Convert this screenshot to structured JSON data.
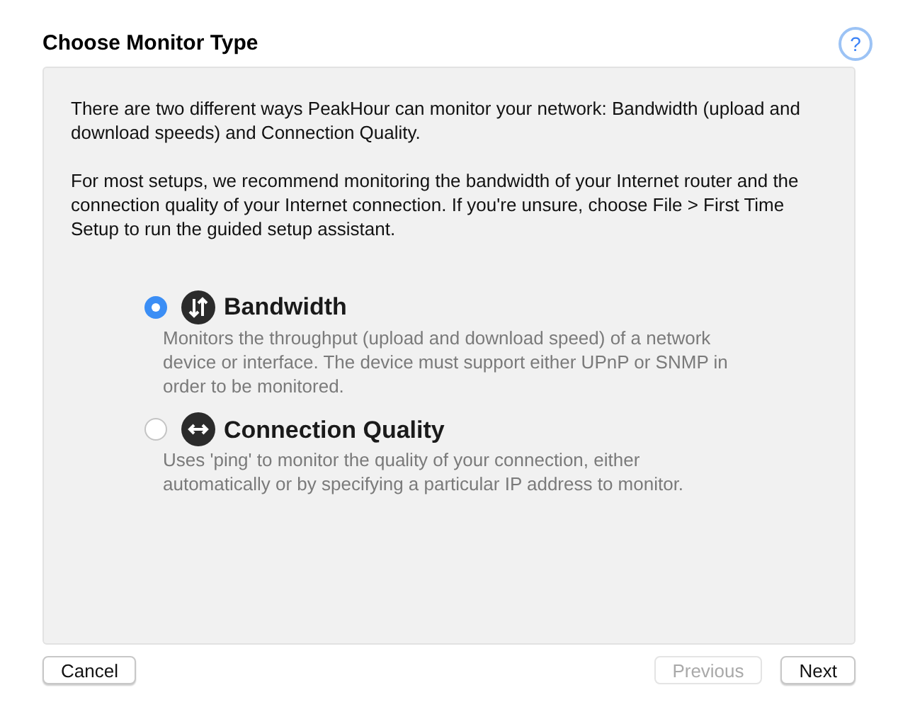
{
  "title": "Choose Monitor Type",
  "intro": [
    "There are two different ways PeakHour can monitor your network: Bandwidth (upload and download speeds) and Connection Quality.",
    "For most setups, we recommend monitoring the bandwidth of your Internet router and the connection quality of your Internet connection. If you're unsure, choose File > First Time Setup to run the guided setup assistant."
  ],
  "options": [
    {
      "kind": "bandwidth",
      "label": "Bandwidth",
      "description": "Monitors the throughput (upload and download speed) of a network device or interface. The device must support either UPnP or SNMP in order to be monitored.",
      "selected": true
    },
    {
      "kind": "quality",
      "label": "Connection Quality",
      "description": "Uses 'ping' to monitor the quality of your connection, either automatically or by specifying a particular IP address to monitor.",
      "selected": false
    }
  ],
  "buttons": [
    {
      "label": "Cancel",
      "disabled": false
    },
    {
      "label": "Previous",
      "disabled": true
    },
    {
      "label": "Next",
      "disabled": false
    }
  ],
  "help": {
    "label": "?"
  }
}
